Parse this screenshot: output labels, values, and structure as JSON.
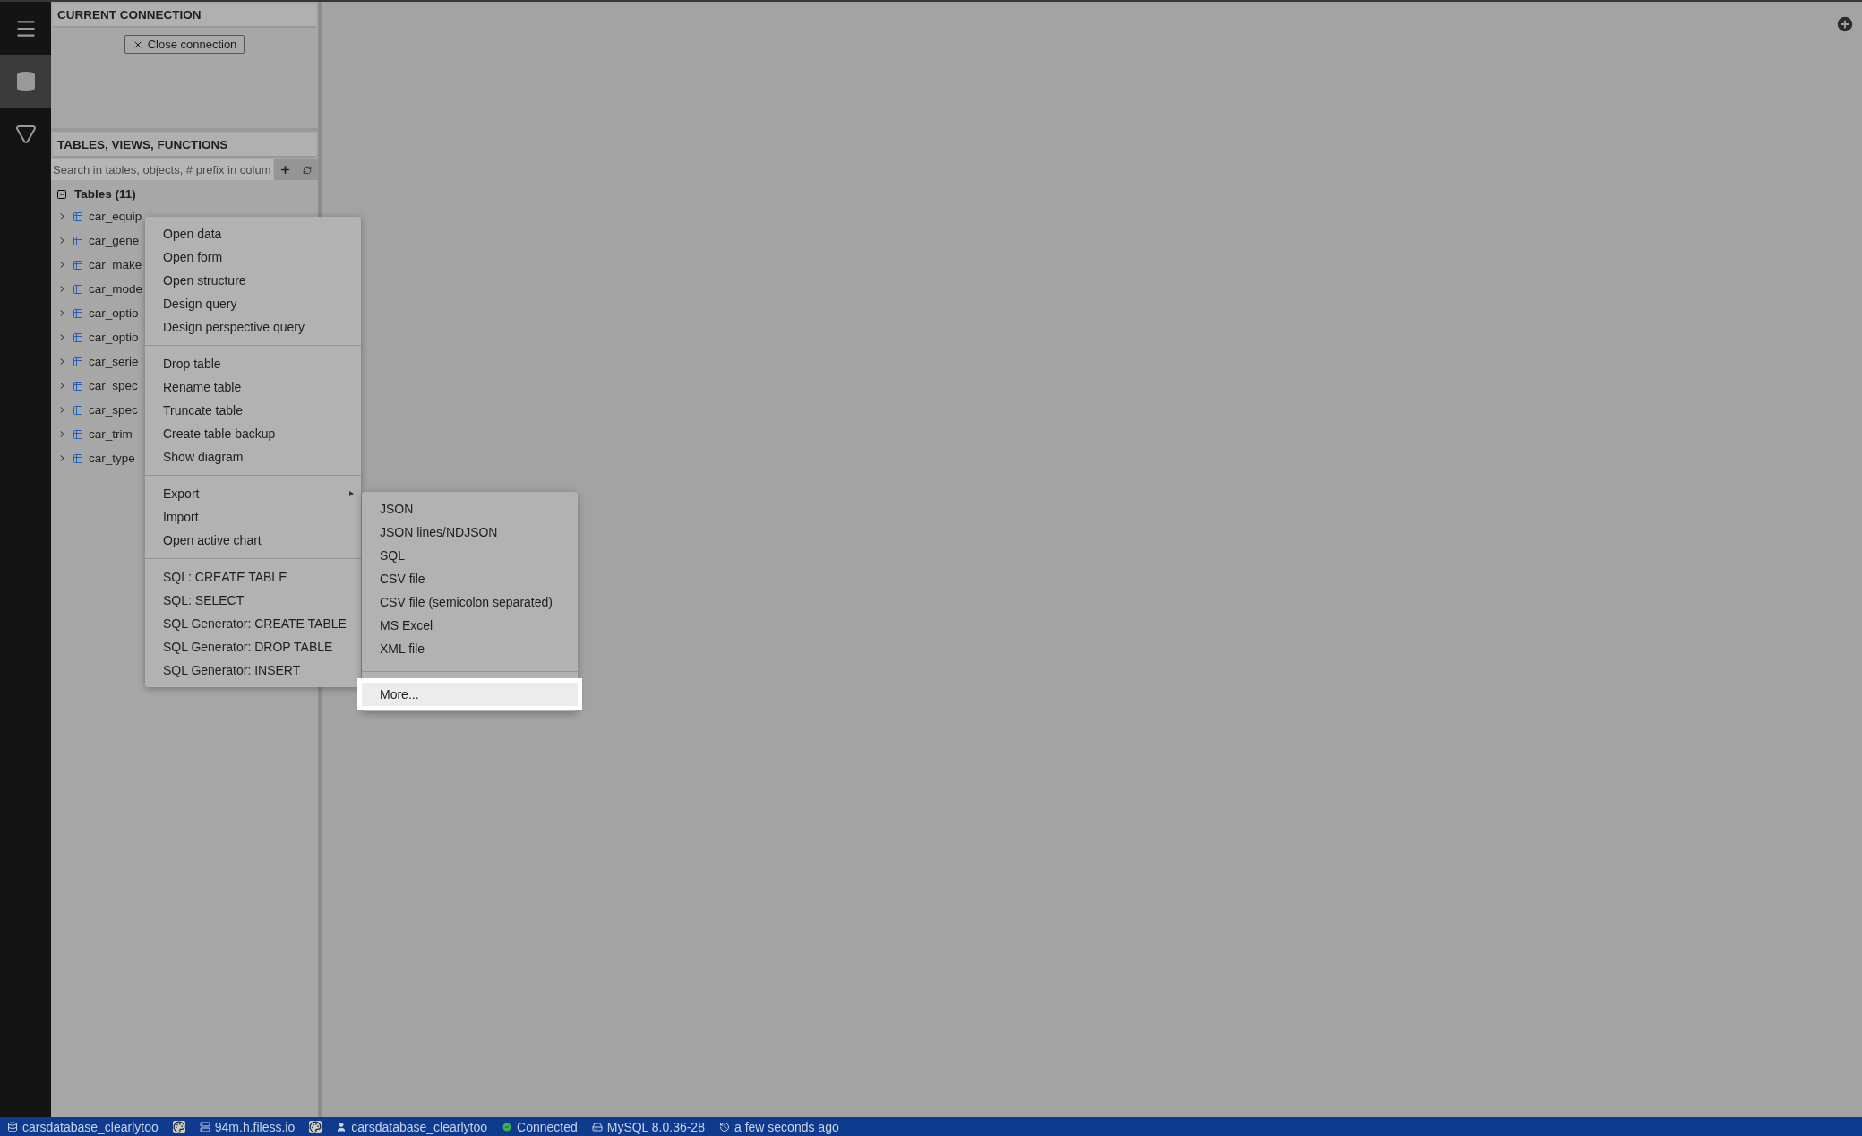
{
  "sidebar": {
    "items": [
      {
        "kind": "menu",
        "selected": false
      },
      {
        "kind": "database",
        "selected": true
      },
      {
        "kind": "filter",
        "selected": false
      }
    ]
  },
  "connection_panel": {
    "title": "CURRENT CONNECTION",
    "close_button": "Close connection"
  },
  "objects_panel": {
    "title": "TABLES, VIEWS, FUNCTIONS",
    "search": {
      "placeholder": "Search in tables, objects, # prefix in colum"
    },
    "tree": {
      "label": "Tables (11)",
      "expanded": true,
      "children": [
        {
          "label": "car_equip"
        },
        {
          "label": "car_gene"
        },
        {
          "label": "car_make"
        },
        {
          "label": "car_mode"
        },
        {
          "label": "car_optio"
        },
        {
          "label": "car_optio"
        },
        {
          "label": "car_serie"
        },
        {
          "label": "car_spec"
        },
        {
          "label": "car_spec"
        },
        {
          "label": "car_trim"
        },
        {
          "label": "car_type"
        }
      ]
    }
  },
  "context_menu": {
    "groups": [
      [
        {
          "label": "Open data",
          "has_submenu": false
        },
        {
          "label": "Open form",
          "has_submenu": false
        },
        {
          "label": "Open structure",
          "has_submenu": false
        },
        {
          "label": "Design query",
          "has_submenu": false
        },
        {
          "label": "Design perspective query",
          "has_submenu": false
        }
      ],
      [
        {
          "label": "Drop table",
          "has_submenu": false
        },
        {
          "label": "Rename table",
          "has_submenu": false
        },
        {
          "label": "Truncate table",
          "has_submenu": false
        },
        {
          "label": "Create table backup",
          "has_submenu": false
        },
        {
          "label": "Show diagram",
          "has_submenu": false
        }
      ],
      [
        {
          "label": "Export",
          "has_submenu": true
        },
        {
          "label": "Import",
          "has_submenu": false
        },
        {
          "label": "Open active chart",
          "has_submenu": false
        }
      ],
      [
        {
          "label": "SQL: CREATE TABLE",
          "has_submenu": false
        },
        {
          "label": "SQL: SELECT",
          "has_submenu": false
        },
        {
          "label": "SQL Generator: CREATE TABLE",
          "has_submenu": false
        },
        {
          "label": "SQL Generator: DROP TABLE",
          "has_submenu": false
        },
        {
          "label": "SQL Generator: INSERT",
          "has_submenu": false
        }
      ]
    ]
  },
  "export_submenu": {
    "groups": [
      [
        {
          "label": "JSON",
          "selected": false
        },
        {
          "label": "JSON lines/NDJSON",
          "selected": false
        },
        {
          "label": "SQL",
          "selected": false
        },
        {
          "label": "CSV file",
          "selected": false
        },
        {
          "label": "CSV file (semicolon separated)",
          "selected": false
        },
        {
          "label": "MS Excel",
          "selected": false
        },
        {
          "label": "XML file",
          "selected": false
        }
      ],
      [
        {
          "label": "More...",
          "selected": true
        }
      ]
    ]
  },
  "status_bar": [
    {
      "kind": "database",
      "text": "carsdatabase_clearlytoo"
    },
    {
      "kind": "palette"
    },
    {
      "kind": "server",
      "text": "94m.h.filess.io"
    },
    {
      "kind": "palette"
    },
    {
      "kind": "user",
      "text": "carsdatabase_clearlytoo"
    },
    {
      "kind": "connected",
      "text": "Connected"
    },
    {
      "kind": "engine",
      "text": "MySQL 8.0.36-28"
    },
    {
      "kind": "history",
      "text": "a few seconds ago"
    }
  ]
}
